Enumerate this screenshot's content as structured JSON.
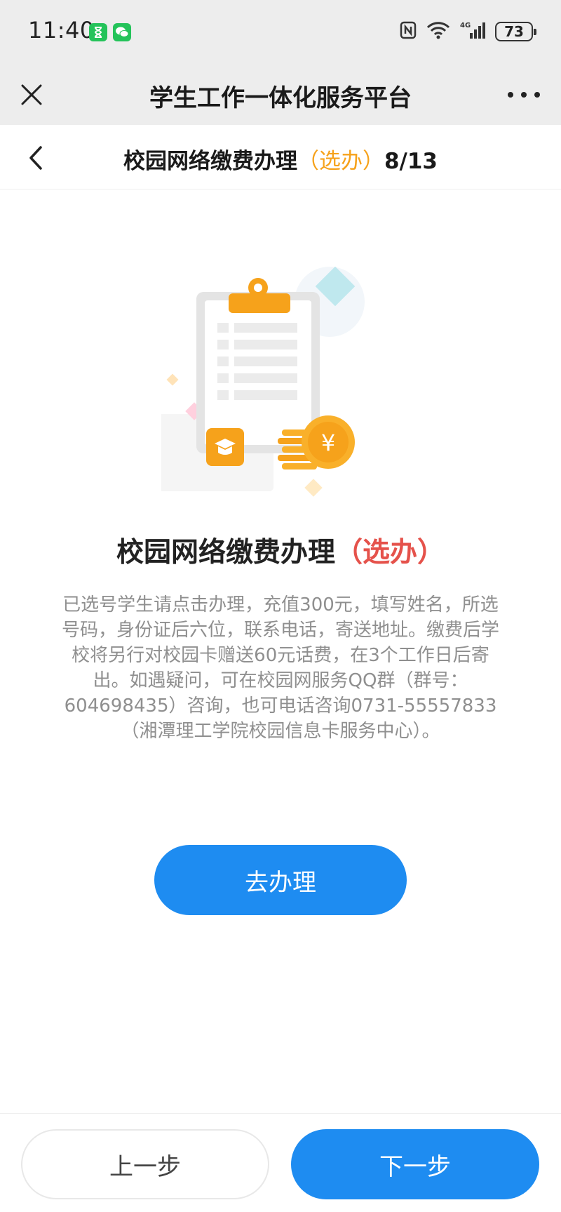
{
  "status_bar": {
    "time": "11:40",
    "battery": "73",
    "icons": [
      "hourglass-icon",
      "wechat-icon",
      "nfc-icon",
      "wifi-icon",
      "4g-signal-icon",
      "battery-icon"
    ]
  },
  "title_bar": {
    "title": "学生工作一体化服务平台"
  },
  "page_header": {
    "title": "校园网络缴费办理",
    "tag": "（选办）",
    "progress": "8/13"
  },
  "content": {
    "title": "校园网络缴费办理",
    "tag": "（选办）",
    "description": "已选号学生请点击办理，充值300元，填写姓名，所选号码，身份证后六位，联系电话，寄送地址。缴费后学校将另行对校园卡赠送60元话费，在3个工作日后寄出。如遇疑问，可在校园网服务QQ群（群号：604698435）咨询，也可电话咨询0731-55557833（湘潭理工学院校园信息卡服务中心）。",
    "go_button": "去办理"
  },
  "footer": {
    "prev": "上一步",
    "next": "下一步"
  },
  "colors": {
    "primary": "#1e8cf1",
    "orange": "#f6a21b",
    "red_tag": "#e5524b",
    "title_bar_bg": "#ededed"
  }
}
